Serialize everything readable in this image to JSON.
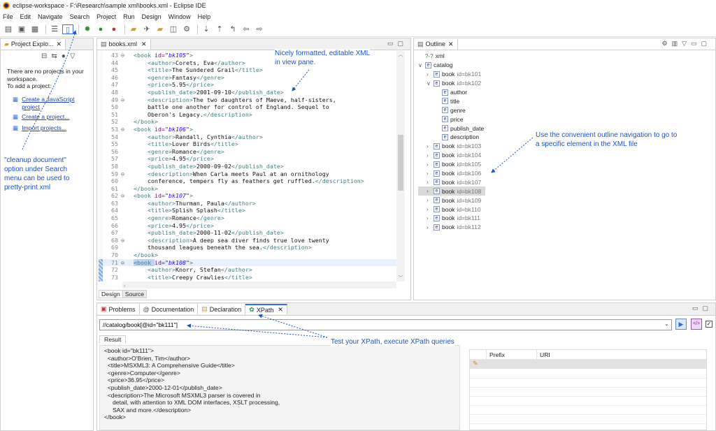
{
  "window": {
    "title": "eclipse-workspace - F:\\Research\\sample xml\\books.xml - Eclipse IDE"
  },
  "menu": [
    "File",
    "Edit",
    "Navigate",
    "Search",
    "Project",
    "Run",
    "Design",
    "Window",
    "Help"
  ],
  "project_explorer": {
    "tab": "Project Explo...",
    "message_lines": [
      "There are no projects in your",
      "workspace.",
      "To add a project:"
    ],
    "links": [
      "Create a JavaScript",
      "project",
      "Create a project...",
      "Import projects..."
    ]
  },
  "editor": {
    "tab": "books.xml",
    "bottom_tabs": [
      "Design",
      "Source"
    ],
    "lines": [
      {
        "n": "43",
        "fold": "⊖",
        "i": "  ",
        "p": [
          [
            "tg",
            "<book "
          ],
          [
            "at",
            "id="
          ],
          [
            "av",
            "\"bk105\""
          ],
          [
            "tg",
            ">"
          ]
        ]
      },
      {
        "n": "44",
        "i": "      ",
        "p": [
          [
            "tg",
            "<author>"
          ],
          [
            "tx",
            "Corets, Eva"
          ],
          [
            "tg",
            "</author>"
          ]
        ]
      },
      {
        "n": "45",
        "i": "      ",
        "p": [
          [
            "tg",
            "<title>"
          ],
          [
            "tx",
            "The Sundered Grail"
          ],
          [
            "tg",
            "</title>"
          ]
        ]
      },
      {
        "n": "46",
        "i": "      ",
        "p": [
          [
            "tg",
            "<genre>"
          ],
          [
            "tx",
            "Fantasy"
          ],
          [
            "tg",
            "</genre>"
          ]
        ]
      },
      {
        "n": "47",
        "i": "      ",
        "p": [
          [
            "tg",
            "<price>"
          ],
          [
            "tx",
            "5.95"
          ],
          [
            "tg",
            "</price>"
          ]
        ]
      },
      {
        "n": "48",
        "i": "      ",
        "p": [
          [
            "tg",
            "<publish_date>"
          ],
          [
            "tx",
            "2001-09-10"
          ],
          [
            "tg",
            "</publish_date>"
          ]
        ]
      },
      {
        "n": "49",
        "fold": "⊖",
        "i": "      ",
        "p": [
          [
            "tg",
            "<description>"
          ],
          [
            "tx",
            "The two daughters of Maeve, half-sisters,"
          ]
        ]
      },
      {
        "n": "50",
        "i": "      ",
        "p": [
          [
            "tx",
            "battle one another for control of England. Sequel to"
          ]
        ]
      },
      {
        "n": "51",
        "i": "      ",
        "p": [
          [
            "tx",
            "Oberon's Legacy."
          ],
          [
            "tg",
            "</description>"
          ]
        ]
      },
      {
        "n": "52",
        "i": "  ",
        "p": [
          [
            "tg",
            "</book>"
          ]
        ]
      },
      {
        "n": "53",
        "fold": "⊖",
        "i": "  ",
        "p": [
          [
            "tg",
            "<book "
          ],
          [
            "at",
            "id="
          ],
          [
            "av",
            "\"bk106\""
          ],
          [
            "tg",
            ">"
          ]
        ]
      },
      {
        "n": "54",
        "i": "      ",
        "p": [
          [
            "tg",
            "<author>"
          ],
          [
            "tx",
            "Randall, Cynthia"
          ],
          [
            "tg",
            "</author>"
          ]
        ]
      },
      {
        "n": "55",
        "i": "      ",
        "p": [
          [
            "tg",
            "<title>"
          ],
          [
            "tx",
            "Lover Birds"
          ],
          [
            "tg",
            "</title>"
          ]
        ]
      },
      {
        "n": "56",
        "i": "      ",
        "p": [
          [
            "tg",
            "<genre>"
          ],
          [
            "tx",
            "Romance"
          ],
          [
            "tg",
            "</genre>"
          ]
        ]
      },
      {
        "n": "57",
        "i": "      ",
        "p": [
          [
            "tg",
            "<price>"
          ],
          [
            "tx",
            "4.95"
          ],
          [
            "tg",
            "</price>"
          ]
        ]
      },
      {
        "n": "58",
        "i": "      ",
        "p": [
          [
            "tg",
            "<publish_date>"
          ],
          [
            "tx",
            "2000-09-02"
          ],
          [
            "tg",
            "</publish_date>"
          ]
        ]
      },
      {
        "n": "59",
        "fold": "⊖",
        "i": "      ",
        "p": [
          [
            "tg",
            "<description>"
          ],
          [
            "tx",
            "When Carla meets Paul at an ornithology"
          ]
        ]
      },
      {
        "n": "60",
        "i": "      ",
        "p": [
          [
            "tx",
            "conference, tempers fly as feathers get ruffled."
          ],
          [
            "tg",
            "</description>"
          ]
        ]
      },
      {
        "n": "61",
        "i": "  ",
        "p": [
          [
            "tg",
            "</book>"
          ]
        ]
      },
      {
        "n": "62",
        "fold": "⊖",
        "i": "  ",
        "p": [
          [
            "tg",
            "<book "
          ],
          [
            "at",
            "id="
          ],
          [
            "av",
            "\"bk107\""
          ],
          [
            "tg",
            ">"
          ]
        ]
      },
      {
        "n": "63",
        "i": "      ",
        "p": [
          [
            "tg",
            "<author>"
          ],
          [
            "tx",
            "Thurman, Paula"
          ],
          [
            "tg",
            "</author>"
          ]
        ]
      },
      {
        "n": "64",
        "i": "      ",
        "p": [
          [
            "tg",
            "<title>"
          ],
          [
            "tx",
            "Splish Splash"
          ],
          [
            "tg",
            "</title>"
          ]
        ]
      },
      {
        "n": "65",
        "i": "      ",
        "p": [
          [
            "tg",
            "<genre>"
          ],
          [
            "tx",
            "Romance"
          ],
          [
            "tg",
            "</genre>"
          ]
        ]
      },
      {
        "n": "66",
        "i": "      ",
        "p": [
          [
            "tg",
            "<price>"
          ],
          [
            "tx",
            "4.95"
          ],
          [
            "tg",
            "</price>"
          ]
        ]
      },
      {
        "n": "67",
        "i": "      ",
        "p": [
          [
            "tg",
            "<publish_date>"
          ],
          [
            "tx",
            "2000-11-02"
          ],
          [
            "tg",
            "</publish_date>"
          ]
        ]
      },
      {
        "n": "68",
        "fold": "⊖",
        "i": "      ",
        "p": [
          [
            "tg",
            "<description>"
          ],
          [
            "tx",
            "A deep sea diver finds true love twenty"
          ]
        ]
      },
      {
        "n": "69",
        "i": "      ",
        "p": [
          [
            "tx",
            "thousand leagues beneath the sea."
          ],
          [
            "tg",
            "</description>"
          ]
        ]
      },
      {
        "n": "70",
        "i": "  ",
        "p": [
          [
            "tg",
            "</book>"
          ]
        ]
      },
      {
        "n": "71",
        "fold": "⊖",
        "i": "  ",
        "hl": true,
        "p": [
          [
            "tg",
            "<book "
          ],
          [
            "at",
            "id="
          ],
          [
            "av",
            "\"bk108\""
          ],
          [
            "tg",
            ">"
          ]
        ]
      },
      {
        "n": "72",
        "i": "      ",
        "p": [
          [
            "tg",
            "<author>"
          ],
          [
            "tx",
            "Knorr, Stefan"
          ],
          [
            "tg",
            "</author>"
          ]
        ]
      },
      {
        "n": "73",
        "i": "      ",
        "p": [
          [
            "tg",
            "<title>"
          ],
          [
            "tx",
            "Creepy Crawlies"
          ],
          [
            "tg",
            "</title>"
          ]
        ]
      }
    ]
  },
  "outline": {
    "tab": "Outline",
    "rows": [
      {
        "d": 0,
        "tw": "",
        "icon": "?-?",
        "label": "xml"
      },
      {
        "d": 0,
        "tw": "∨",
        "icon": "e",
        "label": "catalog"
      },
      {
        "d": 1,
        "tw": "›",
        "icon": "e",
        "label": "book",
        "attr": "id=bk101"
      },
      {
        "d": 1,
        "tw": "∨",
        "icon": "e",
        "label": "book",
        "attr": "id=bk102"
      },
      {
        "d": 2,
        "tw": "",
        "icon": "e",
        "label": "author"
      },
      {
        "d": 2,
        "tw": "",
        "icon": "e",
        "label": "title"
      },
      {
        "d": 2,
        "tw": "",
        "icon": "e",
        "label": "genre"
      },
      {
        "d": 2,
        "tw": "",
        "icon": "e",
        "label": "price"
      },
      {
        "d": 2,
        "tw": "",
        "icon": "e",
        "label": "publish_date"
      },
      {
        "d": 2,
        "tw": "",
        "icon": "e",
        "label": "description"
      },
      {
        "d": 1,
        "tw": "›",
        "icon": "e",
        "label": "book",
        "attr": "id=bk103"
      },
      {
        "d": 1,
        "tw": "›",
        "icon": "e",
        "label": "book",
        "attr": "id=bk104"
      },
      {
        "d": 1,
        "tw": "›",
        "icon": "e",
        "label": "book",
        "attr": "id=bk105"
      },
      {
        "d": 1,
        "tw": "›",
        "icon": "e",
        "label": "book",
        "attr": "id=bk106"
      },
      {
        "d": 1,
        "tw": "›",
        "icon": "e",
        "label": "book",
        "attr": "id=bk107"
      },
      {
        "d": 1,
        "tw": "›",
        "icon": "e",
        "label": "book",
        "attr": "id=bk108",
        "sel": true
      },
      {
        "d": 1,
        "tw": "›",
        "icon": "e",
        "label": "book",
        "attr": "id=bk109"
      },
      {
        "d": 1,
        "tw": "›",
        "icon": "e",
        "label": "book",
        "attr": "id=bk110"
      },
      {
        "d": 1,
        "tw": "›",
        "icon": "e",
        "label": "book",
        "attr": "id=bk111"
      },
      {
        "d": 1,
        "tw": "›",
        "icon": "e",
        "label": "book",
        "attr": "id=bk112"
      }
    ]
  },
  "bottom_tabs": [
    "Problems",
    "Documentation",
    "Declaration",
    "XPath"
  ],
  "xpath": {
    "query": "//catalog/book[@id=\"bk111\"]",
    "result_tab": "Result",
    "result_lines": [
      "<book id=\"bk111\">",
      "  <author>O'Brien, Tim</author>",
      "  <title>MSXML3: A Comprehensive Guide</title>",
      "  <genre>Computer</genre>",
      "  <price>36.95</price>",
      "  <publish_date>2000-12-01</publish_date>",
      "  <description>The Microsoft MSXML3 parser is covered in",
      "     detail, with attention to XML DOM interfaces, XSLT processing,",
      "     SAX and more.</description>",
      "</book>"
    ],
    "ns_headers": [
      "Prefix",
      "URI"
    ]
  },
  "annotations": {
    "editor_note": [
      "Nicely formatted, editable XML",
      "in view pane."
    ],
    "outline_note": [
      "Use the convenient outline navigation to go to",
      "a specific element in the XML file"
    ],
    "cleanup_note": [
      "\"cleanup document\"",
      "option under Search",
      "menu can be used to",
      "pretty-print xml"
    ],
    "xpath_note": "Test your XPath, execute XPath queries"
  },
  "colors": {
    "annotation": "#1e52c6",
    "tag": "#3f7f7f",
    "attr": "#7f007f",
    "value": "#2a00ff"
  }
}
